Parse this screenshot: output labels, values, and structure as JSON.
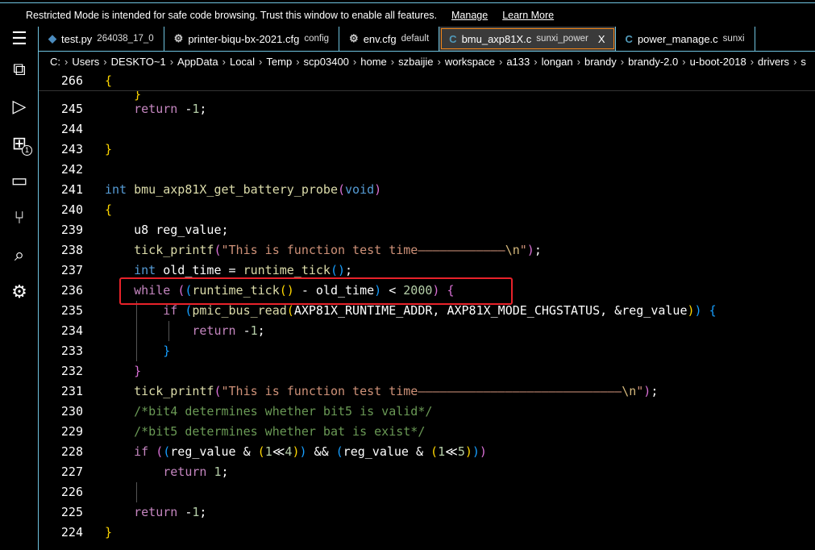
{
  "banner": {
    "text": "Restricted Mode is intended for safe code browsing. Trust this window to enable all features.",
    "manage": "Manage",
    "learn_more": "Learn More"
  },
  "activity_bar": [
    {
      "icon": "menu-icon",
      "glyph": "☰"
    },
    {
      "icon": "explorer-icon",
      "glyph": "⧉"
    },
    {
      "icon": "run-debug-icon",
      "glyph": "▷"
    },
    {
      "icon": "extensions-icon",
      "glyph": "⊞",
      "badge": "1"
    },
    {
      "icon": "remote-explorer-icon",
      "glyph": "▭"
    },
    {
      "icon": "source-control-icon",
      "glyph": "⑂"
    },
    {
      "icon": "search-icon",
      "glyph": "⌕"
    },
    {
      "icon": "tools-icon",
      "glyph": "⚙"
    }
  ],
  "tabs": [
    {
      "name": "test.py",
      "desc": "264038_17_0",
      "icon": "python-icon",
      "glyph": "◆",
      "color": "#4b8bbe"
    },
    {
      "name": "printer-biqu-bx-2021.cfg",
      "desc": "config",
      "icon": "gear-icon",
      "glyph": "⚙",
      "color": "#ccc"
    },
    {
      "name": "env.cfg",
      "desc": "default",
      "icon": "gear-icon",
      "glyph": "⚙",
      "color": "#ccc"
    },
    {
      "name": "bmu_axp81X.c",
      "desc": "sunxi_power",
      "icon": "c-file-icon",
      "glyph": "C",
      "color": "#519aba",
      "active": true,
      "close": "X"
    },
    {
      "name": "power_manage.c",
      "desc": "sunxi",
      "icon": "c-file-icon",
      "glyph": "C",
      "color": "#519aba"
    }
  ],
  "breadcrumbs": [
    "C:",
    "Users",
    "DESKTO~1",
    "AppData",
    "Local",
    "Temp",
    "scp03400",
    "home",
    "szbaijie",
    "workspace",
    "a133",
    "longan",
    "brandy",
    "brandy-2.0",
    "u-boot-2018",
    "drivers",
    "s"
  ],
  "sticky": {
    "ln": "266",
    "tokens": [
      [
        "{",
        "pn"
      ]
    ]
  },
  "lines": [
    {
      "ln": "245",
      "tokens": [
        [
          "    ",
          ""
        ],
        [
          "return",
          "ctl"
        ],
        [
          " -",
          "id"
        ],
        [
          "1",
          "num"
        ],
        [
          ";",
          "id"
        ]
      ]
    },
    {
      "ln": "244",
      "tokens": []
    },
    {
      "ln": "243",
      "tokens": [
        [
          "}",
          "pn"
        ]
      ]
    },
    {
      "ln": "242",
      "tokens": []
    },
    {
      "ln": "241",
      "tokens": [
        [
          "int",
          "kw"
        ],
        [
          " ",
          ""
        ],
        [
          "bmu_axp81X_get_battery_probe",
          "fn"
        ],
        [
          "(",
          "pp"
        ],
        [
          "void",
          "kw"
        ],
        [
          ")",
          "pp"
        ]
      ]
    },
    {
      "ln": "240",
      "tokens": [
        [
          "{",
          "pn"
        ]
      ]
    },
    {
      "ln": "239",
      "tokens": [
        [
          "    u8 reg_value;",
          "id"
        ]
      ]
    },
    {
      "ln": "238",
      "tokens": [
        [
          "    ",
          ""
        ],
        [
          "tick_printf",
          "fn"
        ],
        [
          "(",
          "pp"
        ],
        [
          "\"This is function test time————————————",
          "str"
        ],
        [
          "\\n",
          "esc"
        ],
        [
          "\"",
          "str"
        ],
        [
          ")",
          "pp"
        ],
        [
          ";",
          "id"
        ]
      ]
    },
    {
      "ln": "237",
      "tokens": [
        [
          "    ",
          ""
        ],
        [
          "int",
          "kw"
        ],
        [
          " old_time = ",
          "id"
        ],
        [
          "runtime_tick",
          "fn"
        ],
        [
          "()",
          "pb"
        ],
        [
          ";",
          "id"
        ]
      ]
    },
    {
      "ln": "236",
      "tokens": [
        [
          "    ",
          ""
        ],
        [
          "while",
          "ctl"
        ],
        [
          " ",
          "id"
        ],
        [
          "(",
          "pp"
        ],
        [
          "(",
          "pb"
        ],
        [
          "runtime_tick",
          "fn"
        ],
        [
          "()",
          "pn"
        ],
        [
          " - old_time",
          "id"
        ],
        [
          ")",
          "pb"
        ],
        [
          " < ",
          "id"
        ],
        [
          "2000",
          "num"
        ],
        [
          ")",
          "pp"
        ],
        [
          " ",
          "id"
        ],
        [
          "{",
          "pp"
        ]
      ]
    },
    {
      "ln": "235",
      "tokens": [
        [
          "        ",
          ""
        ],
        [
          "if",
          "ctl"
        ],
        [
          " ",
          "id"
        ],
        [
          "(",
          "pb"
        ],
        [
          "pmic_bus_read",
          "fn"
        ],
        [
          "(",
          "pn"
        ],
        [
          "AXP81X_RUNTIME_ADDR, AXP81X_MODE_CHGSTATUS, &reg_value",
          "id"
        ],
        [
          ")",
          "pn"
        ],
        [
          ")",
          "pb"
        ],
        [
          " ",
          "id"
        ],
        [
          "{",
          "pb"
        ]
      ]
    },
    {
      "ln": "234",
      "tokens": [
        [
          "            ",
          ""
        ],
        [
          "return",
          "ctl"
        ],
        [
          " -",
          "id"
        ],
        [
          "1",
          "num"
        ],
        [
          ";",
          "id"
        ]
      ]
    },
    {
      "ln": "233",
      "tokens": [
        [
          "        ",
          ""
        ],
        [
          "}",
          "pb"
        ]
      ]
    },
    {
      "ln": "232",
      "tokens": [
        [
          "    ",
          ""
        ],
        [
          "}",
          "pp"
        ]
      ]
    },
    {
      "ln": "231",
      "tokens": [
        [
          "    ",
          ""
        ],
        [
          "tick_printf",
          "fn"
        ],
        [
          "(",
          "pp"
        ],
        [
          "\"This is function test time————————————————————————————",
          "str"
        ],
        [
          "\\n",
          "esc"
        ],
        [
          "\"",
          "str"
        ],
        [
          ")",
          "pp"
        ],
        [
          ";",
          "id"
        ]
      ]
    },
    {
      "ln": "230",
      "tokens": [
        [
          "    ",
          ""
        ],
        [
          "/*bit4 determines whether bit5 is valid*/",
          "cm"
        ]
      ]
    },
    {
      "ln": "229",
      "tokens": [
        [
          "    ",
          ""
        ],
        [
          "/*bit5 determines whether bat is exist*/",
          "cm"
        ]
      ]
    },
    {
      "ln": "228",
      "tokens": [
        [
          "    ",
          ""
        ],
        [
          "if",
          "ctl"
        ],
        [
          " ",
          "id"
        ],
        [
          "(",
          "pp"
        ],
        [
          "(",
          "pb"
        ],
        [
          "reg_value & ",
          "id"
        ],
        [
          "(",
          "pn"
        ],
        [
          "1",
          "num"
        ],
        [
          "≪",
          "id"
        ],
        [
          "4",
          "num"
        ],
        [
          ")",
          "pn"
        ],
        [
          ")",
          "pb"
        ],
        [
          " && ",
          "id"
        ],
        [
          "(",
          "pb"
        ],
        [
          "reg_value & ",
          "id"
        ],
        [
          "(",
          "pn"
        ],
        [
          "1",
          "num"
        ],
        [
          "≪",
          "id"
        ],
        [
          "5",
          "num"
        ],
        [
          ")",
          "pn"
        ],
        [
          ")",
          "pb"
        ],
        [
          ")",
          "pp"
        ]
      ]
    },
    {
      "ln": "227",
      "tokens": [
        [
          "        ",
          ""
        ],
        [
          "return",
          "ctl"
        ],
        [
          " ",
          "id"
        ],
        [
          "1",
          "num"
        ],
        [
          ";",
          "id"
        ]
      ]
    },
    {
      "ln": "226",
      "tokens": []
    },
    {
      "ln": "225",
      "tokens": [
        [
          "    ",
          ""
        ],
        [
          "return",
          "ctl"
        ],
        [
          " -",
          "id"
        ],
        [
          "1",
          "num"
        ],
        [
          ";",
          "id"
        ]
      ]
    },
    {
      "ln": "224",
      "tokens": [
        [
          "}",
          "pn"
        ]
      ]
    }
  ]
}
